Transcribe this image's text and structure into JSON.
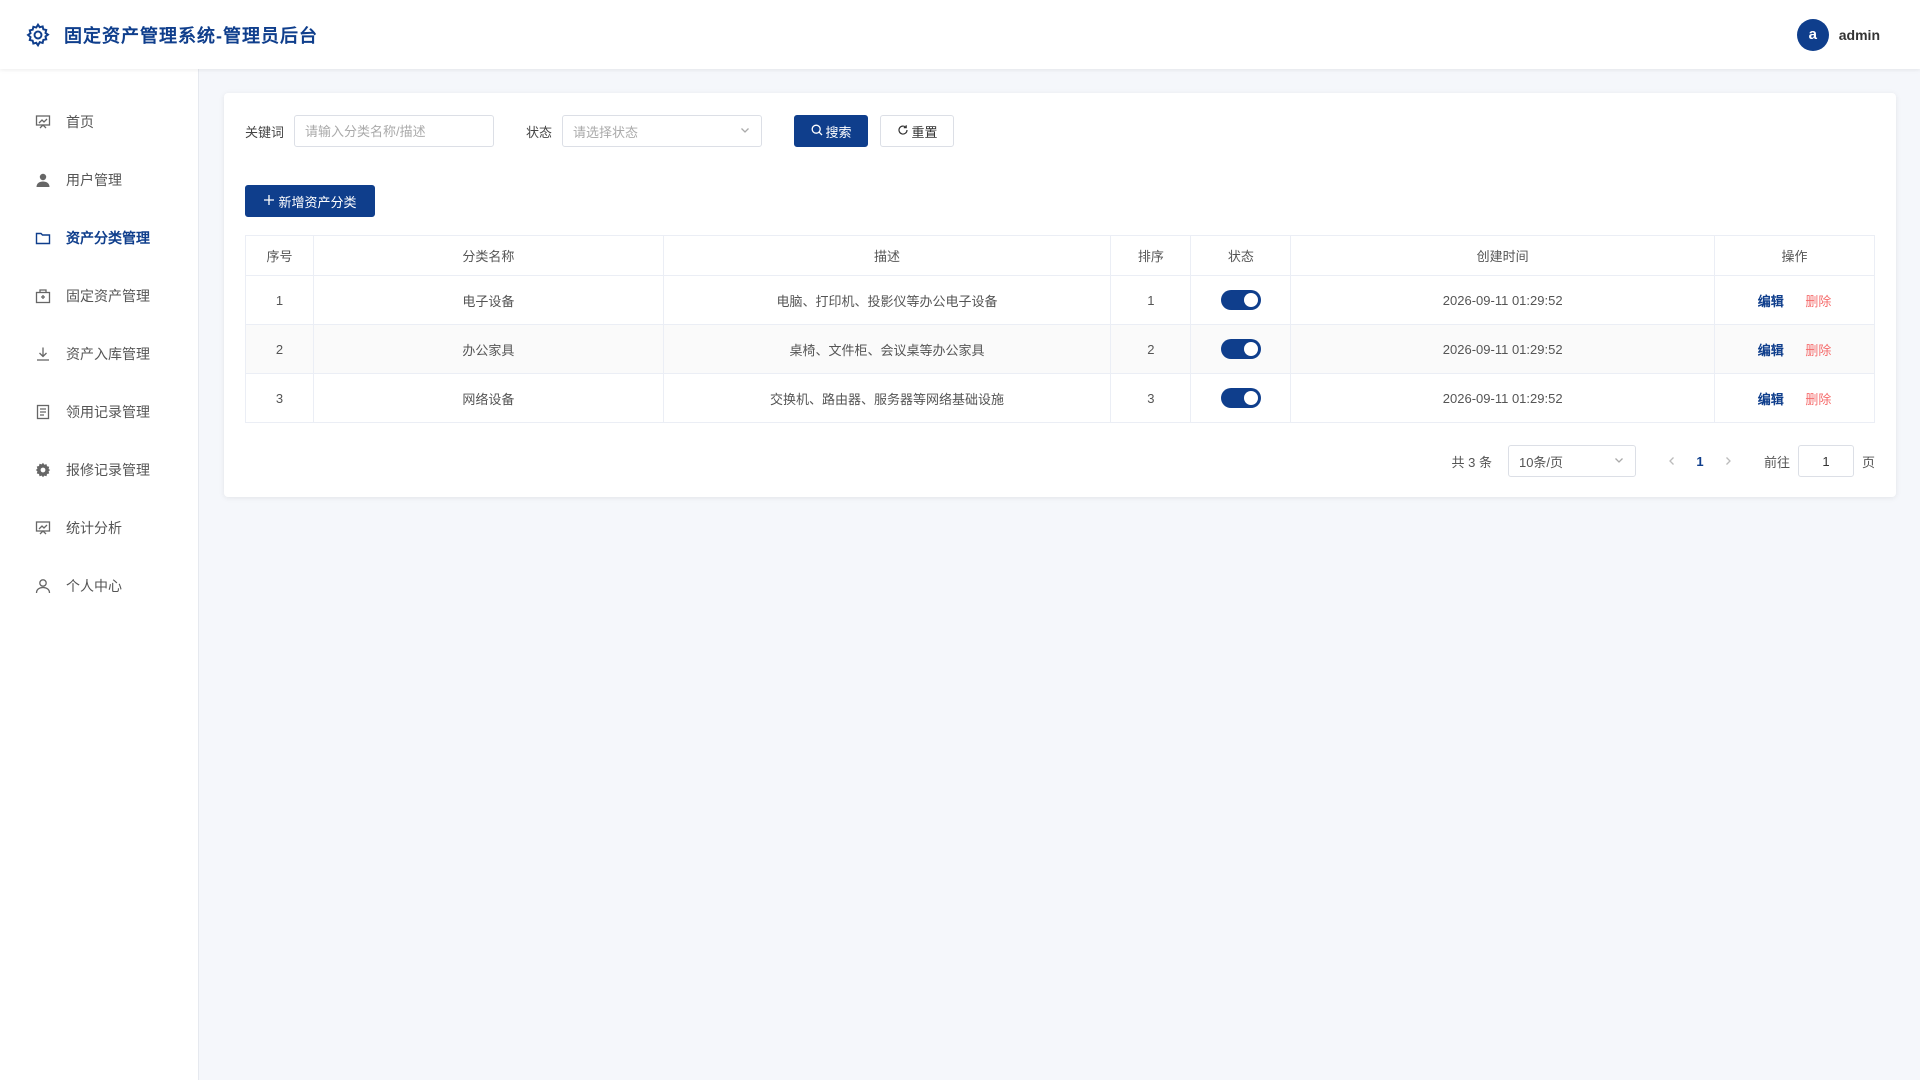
{
  "header": {
    "title": "固定资产管理系统-管理员后台",
    "avatar_letter": "a",
    "username": "admin"
  },
  "sidebar": {
    "items": [
      {
        "label": "首页",
        "icon": "chart-board-icon",
        "active": false
      },
      {
        "label": "用户管理",
        "icon": "user-icon",
        "active": false
      },
      {
        "label": "资产分类管理",
        "icon": "folder-icon",
        "active": true
      },
      {
        "label": "固定资产管理",
        "icon": "box-icon",
        "active": false
      },
      {
        "label": "资产入库管理",
        "icon": "download-icon",
        "active": false
      },
      {
        "label": "领用记录管理",
        "icon": "document-icon",
        "active": false
      },
      {
        "label": "报修记录管理",
        "icon": "gear-icon",
        "active": false
      },
      {
        "label": "统计分析",
        "icon": "chart-board-icon",
        "active": false
      },
      {
        "label": "个人中心",
        "icon": "user-outline-icon",
        "active": false
      }
    ]
  },
  "filters": {
    "keyword_label": "关键词",
    "keyword_placeholder": "请输入分类名称/描述",
    "status_label": "状态",
    "status_placeholder": "请选择状态",
    "search_label": "搜索",
    "reset_label": "重置"
  },
  "toolbar": {
    "add_label": "新增资产分类"
  },
  "table": {
    "columns": [
      "序号",
      "分类名称",
      "描述",
      "排序",
      "状态",
      "创建时间",
      "操作"
    ],
    "rows": [
      {
        "index": "1",
        "name": "电子设备",
        "desc": "电脑、打印机、投影仪等办公电子设备",
        "sort": "1",
        "enabled": true,
        "created": "2026-09-11 01:29:52"
      },
      {
        "index": "2",
        "name": "办公家具",
        "desc": "桌椅、文件柜、会议桌等办公家具",
        "sort": "2",
        "enabled": true,
        "created": "2026-09-11 01:29:52"
      },
      {
        "index": "3",
        "name": "网络设备",
        "desc": "交换机、路由器、服务器等网络基础设施",
        "sort": "3",
        "enabled": true,
        "created": "2026-09-11 01:29:52"
      }
    ],
    "edit_label": "编辑",
    "delete_label": "删除"
  },
  "pagination": {
    "total_text": "共 3 条",
    "page_size": "10条/页",
    "current_page": "1",
    "goto_label": "前往",
    "goto_value": "1",
    "page_unit": "页"
  },
  "colors": {
    "primary": "#0f3e8c",
    "danger": "#f56c6c",
    "background": "#f5f7fb"
  }
}
